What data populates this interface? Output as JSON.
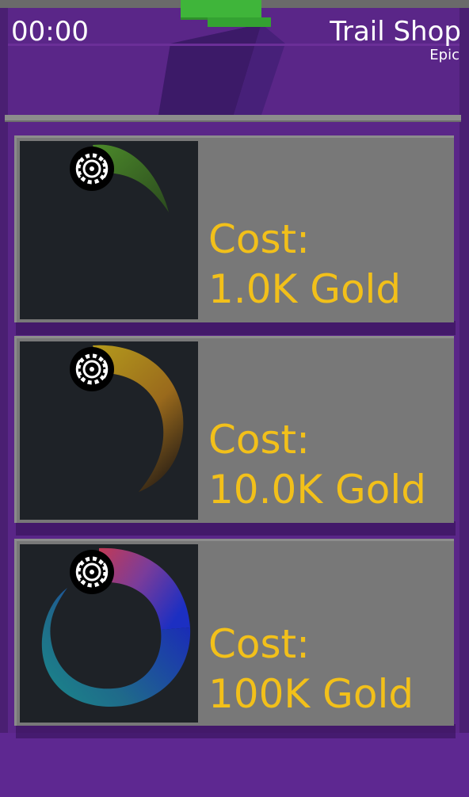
{
  "hud": {
    "timer": "00:00",
    "title": "Trail Shop",
    "subtitle": "Epic"
  },
  "shop": {
    "items": [
      {
        "cost_label": "Cost:",
        "cost_value": "1.0K Gold",
        "trail_icon": "green-trail-icon"
      },
      {
        "cost_label": "Cost:",
        "cost_value": "10.0K Gold",
        "trail_icon": "golden-trail-icon"
      },
      {
        "cost_label": "Cost:",
        "cost_value": "100K Gold",
        "trail_icon": "rainbow-trail-icon"
      }
    ]
  },
  "colors": {
    "background": "#5a2688",
    "card": "#787878",
    "preview": "#1e2227",
    "cost_text": "#f2c01a",
    "hud_text": "#ffffff"
  }
}
